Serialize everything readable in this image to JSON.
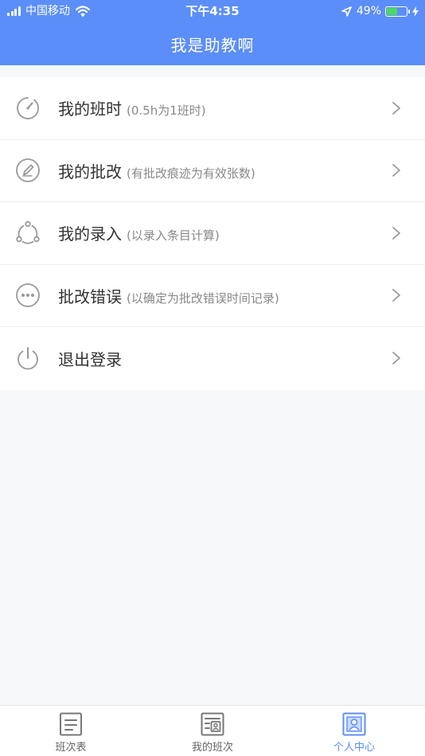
{
  "status_bar": {
    "carrier": "中国移动",
    "time": "下午4:35",
    "battery_percent_label": "49%",
    "battery_level": 0.49,
    "icons": [
      "signal-icon",
      "wifi-icon",
      "location-icon",
      "battery-icon",
      "charging-icon"
    ]
  },
  "nav": {
    "title": "我是助教啊"
  },
  "menu": {
    "items": [
      {
        "label": "我的班时",
        "sub": "(0.5h为1班时)",
        "icon": "speedometer-icon"
      },
      {
        "label": "我的批改",
        "sub": "(有批改痕迹为有效张数)",
        "icon": "pencil-icon"
      },
      {
        "label": "我的录入",
        "sub": "(以录入条目计算)",
        "icon": "share-nodes-icon"
      },
      {
        "label": "批改错误",
        "sub": "(以确定为批改错误时间记录)",
        "icon": "more-dots-icon"
      },
      {
        "label": "退出登录",
        "sub": "",
        "icon": "power-icon"
      }
    ]
  },
  "tabbar": {
    "tabs": [
      {
        "label": "班次表",
        "icon": "schedule-list-icon",
        "active": false
      },
      {
        "label": "我的班次",
        "icon": "my-shifts-icon",
        "active": false
      },
      {
        "label": "个人中心",
        "icon": "profile-icon",
        "active": true
      }
    ]
  },
  "colors": {
    "primary": "#5b8ef8",
    "icon_gray": "#999999",
    "text_dark": "#333333",
    "text_gray": "#888888",
    "battery_green": "#4cd964"
  }
}
